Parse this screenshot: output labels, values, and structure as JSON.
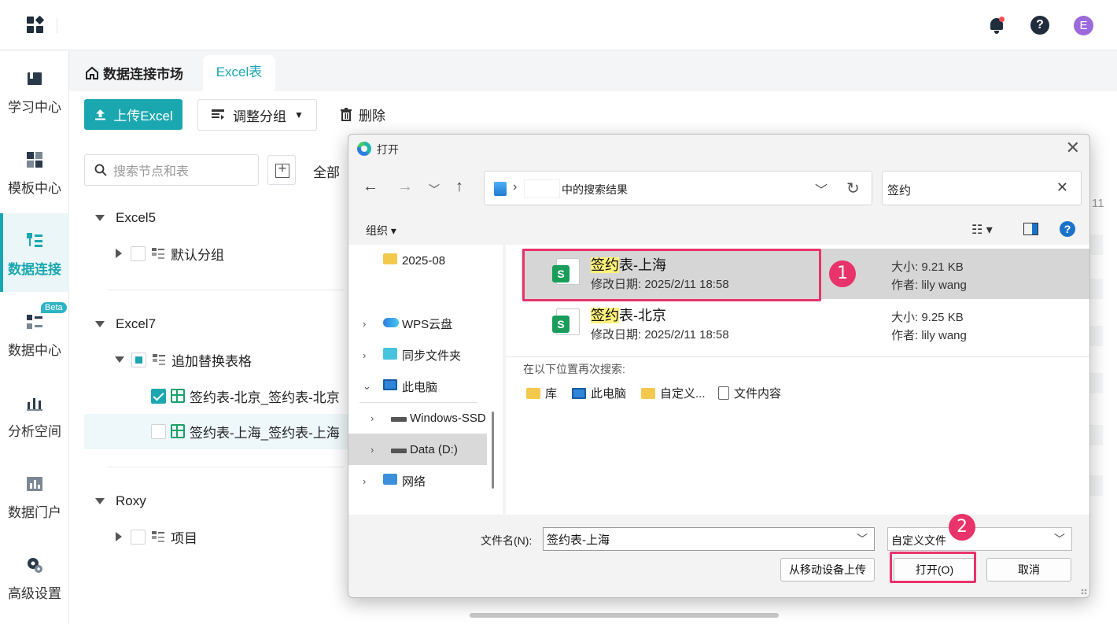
{
  "header": {
    "logo_icon": "app-grid-icon",
    "bell_icon": "bell-icon",
    "help_label": "?",
    "avatar_letter": "E"
  },
  "sidebar": {
    "items": [
      {
        "label": "学习中心",
        "icon": "book-icon"
      },
      {
        "label": "模板中心",
        "icon": "template-icon"
      },
      {
        "label": "数据连接",
        "icon": "data-connect-icon",
        "active": true
      },
      {
        "label": "数据中心",
        "icon": "data-center-icon",
        "badge": "Beta"
      },
      {
        "label": "分析空间",
        "icon": "analysis-icon"
      },
      {
        "label": "数据门户",
        "icon": "portal-icon"
      },
      {
        "label": "高级设置",
        "icon": "settings-gear-icon"
      }
    ]
  },
  "tabs": {
    "home_label": "数据连接市场",
    "current_label": "Excel表"
  },
  "toolbar": {
    "upload_label": "上传Excel",
    "group_label": "调整分组",
    "delete_label": "删除"
  },
  "tree": {
    "search_placeholder": "搜索节点和表",
    "all_label": "全部",
    "nodes": {
      "excel5": "Excel5",
      "default_group": "默认分组",
      "excel7": "Excel7",
      "replace_group": "追加替换表格",
      "sheet_bj": "签约表-北京_签约表-北京",
      "sheet_sh": "签约表-上海_签约表-上海",
      "roxy": "Roxy",
      "project": "项目"
    }
  },
  "background_fragment": "11",
  "dialog": {
    "title": "打开",
    "address_suffix": "中的搜索结果",
    "search_value": "签约",
    "organize_label": "组织 ▾",
    "nav": {
      "folder_2025": "2025-08",
      "wps": "WPS云盘",
      "sync": "同步文件夹",
      "this_pc": "此电脑",
      "windows_ssd": "Windows-SSD",
      "data_d": "Data (D:)",
      "network": "网络"
    },
    "files": [
      {
        "name_highlight": "签约",
        "name_rest": "表-上海",
        "date": "修改日期: 2025/2/11 18:58",
        "size": "大小: 9.21 KB",
        "author": "作者: lily wang",
        "selected": true
      },
      {
        "name_highlight": "签约",
        "name_rest": "表-北京",
        "date": "修改日期: 2025/2/11 18:58",
        "size": "大小: 9.25 KB",
        "author": "作者: lily wang",
        "selected": false
      }
    ],
    "search_again_label": "在以下位置再次搜索:",
    "locations": {
      "library": "库",
      "this_pc": "此电脑",
      "custom": "自定义...",
      "file_content": "文件内容"
    },
    "filename_label": "文件名(N):",
    "filename_value": "签约表-上海",
    "filetype_value": "自定义文件",
    "upload_mobile_label": "从移动设备上传",
    "open_label": "打开(O)",
    "cancel_label": "取消",
    "close_glyph": "✕"
  },
  "annotations": {
    "step1": "1",
    "step2": "2",
    "accent_color": "#e8336b"
  }
}
